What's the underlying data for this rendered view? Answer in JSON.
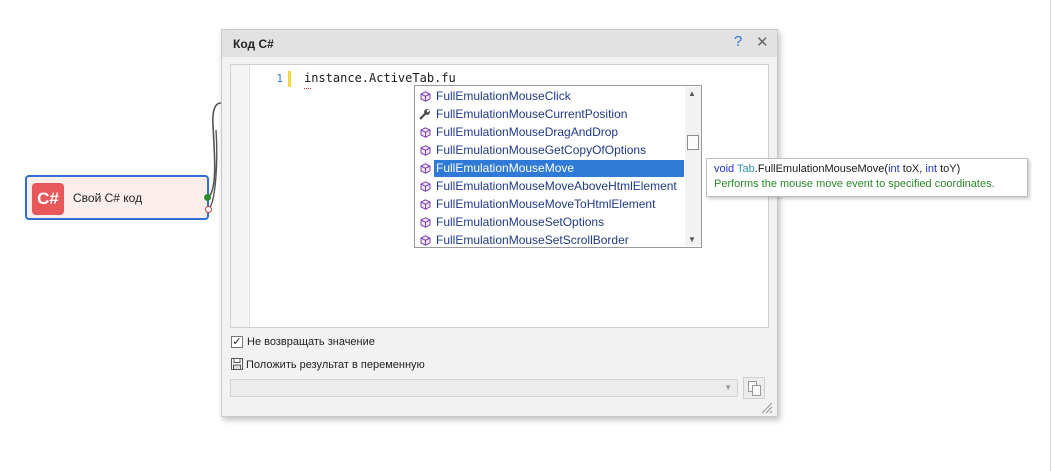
{
  "canvas": {
    "node": {
      "icon_text": "C#",
      "title": "Свой C# код",
      "icon_color": "#e8585a",
      "border_color": "#2f6fd6"
    }
  },
  "dialog": {
    "title": "Код C#",
    "help_label": "?",
    "close_label": "✕",
    "editor": {
      "line_number": "1",
      "code": "instance.ActiveTab.fu"
    },
    "autocomplete": {
      "selected_index": 4,
      "items": [
        {
          "label": "FullEmulationMouseClick",
          "icon": "method-cube-icon"
        },
        {
          "label": "FullEmulationMouseCurrentPosition",
          "icon": "wrench-property-icon"
        },
        {
          "label": "FullEmulationMouseDragAndDrop",
          "icon": "method-cube-icon"
        },
        {
          "label": "FullEmulationMouseGetCopyOfOptions",
          "icon": "method-cube-icon"
        },
        {
          "label": "FullEmulationMouseMove",
          "icon": "method-cube-icon"
        },
        {
          "label": "FullEmulationMouseMoveAboveHtmlElement",
          "icon": "method-cube-icon"
        },
        {
          "label": "FullEmulationMouseMoveToHtmlElement",
          "icon": "method-cube-icon"
        },
        {
          "label": "FullEmulationMouseSetOptions",
          "icon": "method-cube-icon"
        },
        {
          "label": "FullEmulationMouseSetScrollBorder",
          "icon": "method-cube-icon"
        }
      ]
    },
    "tooltip": {
      "void_kw": "void",
      "type_name": "Tab",
      "method": ".FullEmulationMouseMove(",
      "int1": "int",
      "param1": " toX, ",
      "int2": "int",
      "param2": " toY)",
      "description": "Performs the mouse move event to specified coordinates."
    },
    "no_return": {
      "checked": true,
      "label": "Не возвращать значение"
    },
    "save_result": {
      "label": "Положить результат в переменную"
    },
    "variable_select": {
      "value": ""
    }
  }
}
